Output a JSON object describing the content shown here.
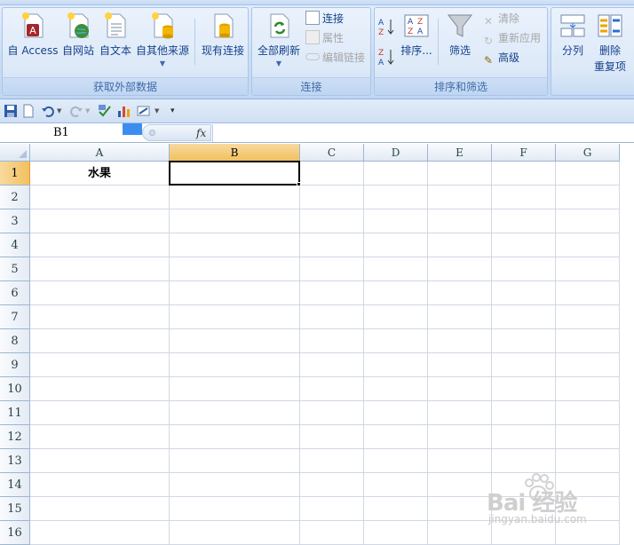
{
  "ribbon": {
    "group_external": {
      "label": "获取外部数据",
      "buttons": [
        "自 Access",
        "自网站",
        "自文本",
        "自其他来源",
        "现有连接"
      ]
    },
    "group_connections": {
      "label": "连接",
      "refresh_all": "全部刷新",
      "connections": "连接",
      "properties": "属性",
      "edit_links": "编辑链接"
    },
    "group_sort": {
      "label": "排序和筛选",
      "sort": "排序...",
      "filter": "筛选",
      "clear": "清除",
      "reapply": "重新应用",
      "advanced": "高级"
    },
    "group_tools": {
      "split": "分列",
      "remove_dup_line1": "删除",
      "remove_dup_line2": "重复项"
    }
  },
  "formula_bar": {
    "name_box": "B1",
    "fx": "fx",
    "value": ""
  },
  "sheet": {
    "columns": [
      "A",
      "B",
      "C",
      "D",
      "E",
      "F",
      "G"
    ],
    "rows": [
      "1",
      "2",
      "3",
      "4",
      "5",
      "6",
      "7",
      "8",
      "9",
      "10",
      "11",
      "12",
      "13",
      "14",
      "15",
      "16"
    ],
    "selected_cell": "B1",
    "cells": {
      "A1": "水果"
    }
  },
  "watermark": {
    "brand": "Bai 经验",
    "url": "jingyan.baidu.com"
  }
}
